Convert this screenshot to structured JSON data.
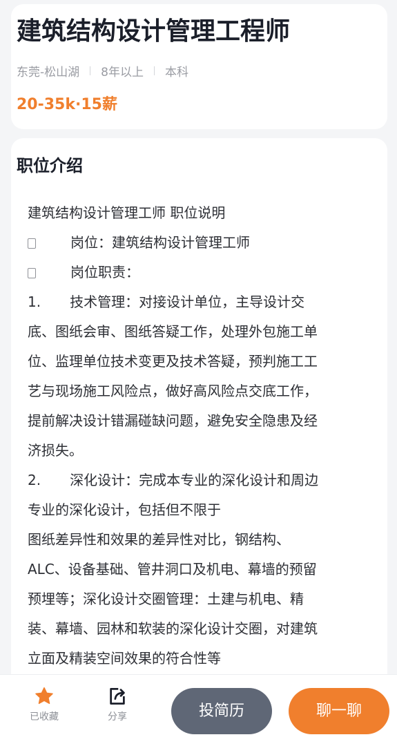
{
  "job": {
    "title": "建筑结构设计管理工程师",
    "location": "东莞-松山湖",
    "experience": "8年以上",
    "education": "本科",
    "salary": "20-35k·15薪"
  },
  "description": {
    "section_title": "职位介绍",
    "lines": [
      {
        "prefix": "",
        "text": "建筑结构设计管理工师 职位说明"
      },
      {
        "prefix": "box",
        "text": "岗位：建筑结构设计管理工师"
      },
      {
        "prefix": "box",
        "text": "岗位职责："
      },
      {
        "prefix": "1.",
        "text": "技术管理：对接设计单位，主导设计交"
      },
      {
        "prefix": "",
        "text": "底、图纸会审、图纸答疑工作，处理外包施工单"
      },
      {
        "prefix": "",
        "text": "位、监理单位技术变更及技术答疑，预判施工工"
      },
      {
        "prefix": "",
        "text": "艺与现场施工风险点，做好高风险点交底工作，"
      },
      {
        "prefix": "",
        "text": "提前解决设计错漏碰缺问题，避免安全隐患及经"
      },
      {
        "prefix": "",
        "text": "济损失。"
      },
      {
        "prefix": "2.",
        "text": "深化设计：完成本专业的深化设计和周边"
      },
      {
        "prefix": "",
        "text": "专业的深化设计，包括但不限于"
      },
      {
        "prefix": "",
        "text": "图纸差异性和效果的差异性对比，钢结构、"
      },
      {
        "prefix": "",
        "text": "ALC、设备基础、管井洞口及机电、幕墙的预留"
      },
      {
        "prefix": "",
        "text": "预埋等；深化设计交圈管理：土建与机电、精"
      },
      {
        "prefix": "",
        "text": "装、幕墙、园林和软装的深化设计交圈，对建筑"
      },
      {
        "prefix": "",
        "text": "立面及精装空间效果的符合性等"
      }
    ]
  },
  "actions": {
    "favorite_label": "已收藏",
    "share_label": "分享",
    "resume_label": "投简历",
    "chat_label": "聊一聊"
  },
  "colors": {
    "accent": "#f07f2d",
    "resume_button": "#5f6776",
    "title_text": "#1b1f2a"
  },
  "icons": {
    "favorite": "star-icon",
    "share": "share-icon"
  }
}
